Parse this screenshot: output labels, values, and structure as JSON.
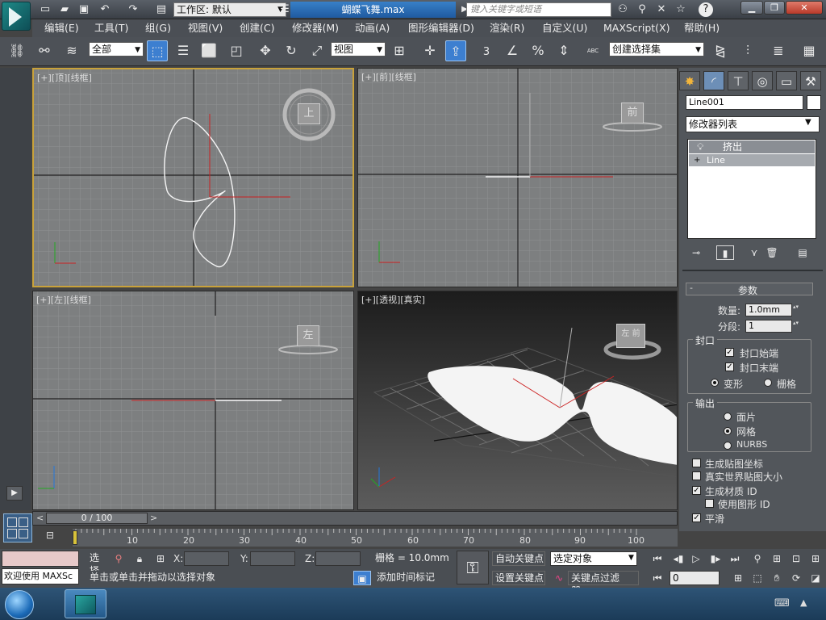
{
  "title": {
    "workspace": "工作区: 默认",
    "document": "蝴蝶飞舞.max",
    "search_placeholder": "键入关键字或短语"
  },
  "menu": [
    "编辑(E)",
    "工具(T)",
    "组(G)",
    "视图(V)",
    "创建(C)",
    "修改器(M)",
    "动画(A)",
    "图形编辑器(D)",
    "渲染(R)",
    "自定义(U)",
    "MAXScript(X)",
    "帮助(H)"
  ],
  "toolbar": {
    "selection_filter": "全部",
    "ref_coord": "视图",
    "named_selection": "创建选择集",
    "snap_label": "3",
    "percent_label": "%",
    "abc_label": "ABC"
  },
  "viewports": {
    "top": {
      "label": "[+][顶][线框]",
      "cube": "上"
    },
    "front": {
      "label": "[+][前][线框]",
      "cube": "前"
    },
    "left": {
      "label": "[+][左][线框]",
      "cube": "左"
    },
    "perspective": {
      "label": "[+][透视][真实]",
      "cube": "左 前"
    }
  },
  "command_panel": {
    "object_name": "Line001",
    "modifier_list": "修改器列表",
    "stack_items": [
      "挤出",
      "Line"
    ],
    "rollout_title": "参数",
    "amount_label": "数量:",
    "amount_value": "1.0mm",
    "segments_label": "分段:",
    "segments_value": "1",
    "capping_title": "封口",
    "cap_start": "封口始端",
    "cap_end": "封口末端",
    "morph": "变形",
    "grid": "栅格",
    "output_title": "输出",
    "patch": "面片",
    "mesh": "网格",
    "nurbs": "NURBS",
    "gen_map_coords": "生成贴图坐标",
    "real_world": "真实世界贴图大小",
    "gen_mat_ids": "生成材质 ID",
    "use_shape_ids": "使用图形 ID",
    "smooth": "平滑"
  },
  "timeline": {
    "frame": "0 / 100",
    "ticks": [
      "10",
      "20",
      "30",
      "40",
      "50",
      "60",
      "70",
      "80",
      "90",
      "100"
    ]
  },
  "status": {
    "script_box": "欢迎使用 MAXSc",
    "selection_mode": "选择",
    "x_label": "X:",
    "y_label": "Y:",
    "z_label": "Z:",
    "grid_info": "栅格 = 10.0mm",
    "prompt": "单击或单击并拖动以选择对象",
    "add_time_tag": "添加时间标记",
    "auto_key": "自动关键点",
    "set_key": "设置关键点",
    "key_target": "选定对象",
    "key_filters": "关键点过滤器...",
    "current_frame": "0"
  }
}
